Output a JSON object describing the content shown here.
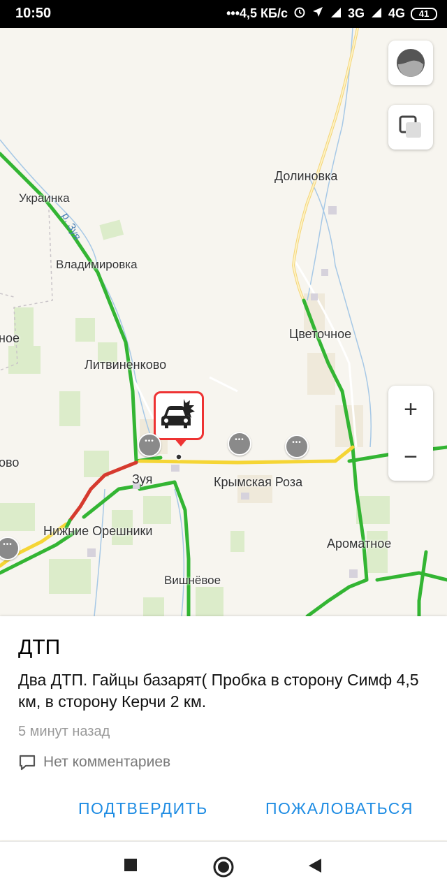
{
  "status_bar": {
    "time": "10:50",
    "network_speed": "•••4,5 КБ/с",
    "signal_1": "3G",
    "signal_2": "4G",
    "battery": "41"
  },
  "map": {
    "places": {
      "dolinovka": "Долиновка",
      "ukrainka": "Украинка",
      "river": "р. Зуя",
      "vladimirovka": "Владимировка",
      "partial_left_1": "ное",
      "tsvetochnoe": "Цветочное",
      "litvinenkovo": "Литвиненково",
      "partial_left_2": "ово",
      "zuya": "Зуя",
      "krymskaya_roza": "Крымская Роза",
      "nizhnie_oreshniki": "Нижние Орешники",
      "aromatnoe": "Ароматное",
      "vishnyovoe": "Вишнёвое"
    },
    "zoom_in": "+",
    "zoom_out": "−",
    "colors": {
      "traffic_free": "#33b533",
      "traffic_slow": "#f5d535",
      "traffic_jam": "#d63a2e",
      "incident": "#e33333",
      "accent": "#1e8ce3"
    }
  },
  "incident": {
    "title": "ДТП",
    "description": "Два ДТП. Гайцы базарят(  Пробка в сторону Симф 4,5 км, в сторону Керчи 2 км.",
    "time_ago": "5 минут назад",
    "comments": "Нет комментариев",
    "confirm_button": "ПОДТВЕРДИТЬ",
    "report_button": "ПОЖАЛОВАТЬСЯ"
  }
}
